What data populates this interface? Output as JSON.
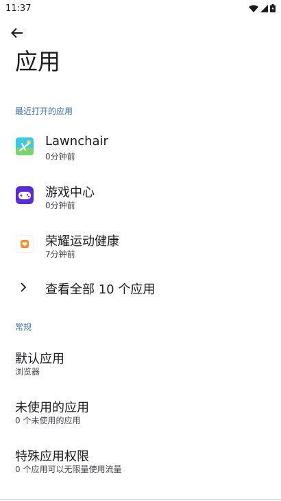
{
  "status_bar": {
    "time": "11:37"
  },
  "page": {
    "title": "应用"
  },
  "recent": {
    "header": "最近打开的应用",
    "apps": [
      {
        "name": "Lawnchair",
        "subtitle": "0分钟前",
        "icon": "lawnchair-icon"
      },
      {
        "name": "游戏中心",
        "subtitle": "0分钟前",
        "icon": "game-center-icon"
      },
      {
        "name": "荣耀运动健康",
        "subtitle": "7分钟前",
        "icon": "honor-health-icon"
      }
    ],
    "see_all": "查看全部 10 个应用"
  },
  "general": {
    "header": "常规",
    "items": [
      {
        "title": "默认应用",
        "subtitle": "浏览器"
      },
      {
        "title": "未使用的应用",
        "subtitle": "0 个未使用的应用"
      },
      {
        "title": "特殊应用权限",
        "subtitle": "0 个应用可以无限量使用流量"
      }
    ]
  },
  "colors": {
    "accent": "#3a6ea5",
    "background": "#ffffff"
  }
}
